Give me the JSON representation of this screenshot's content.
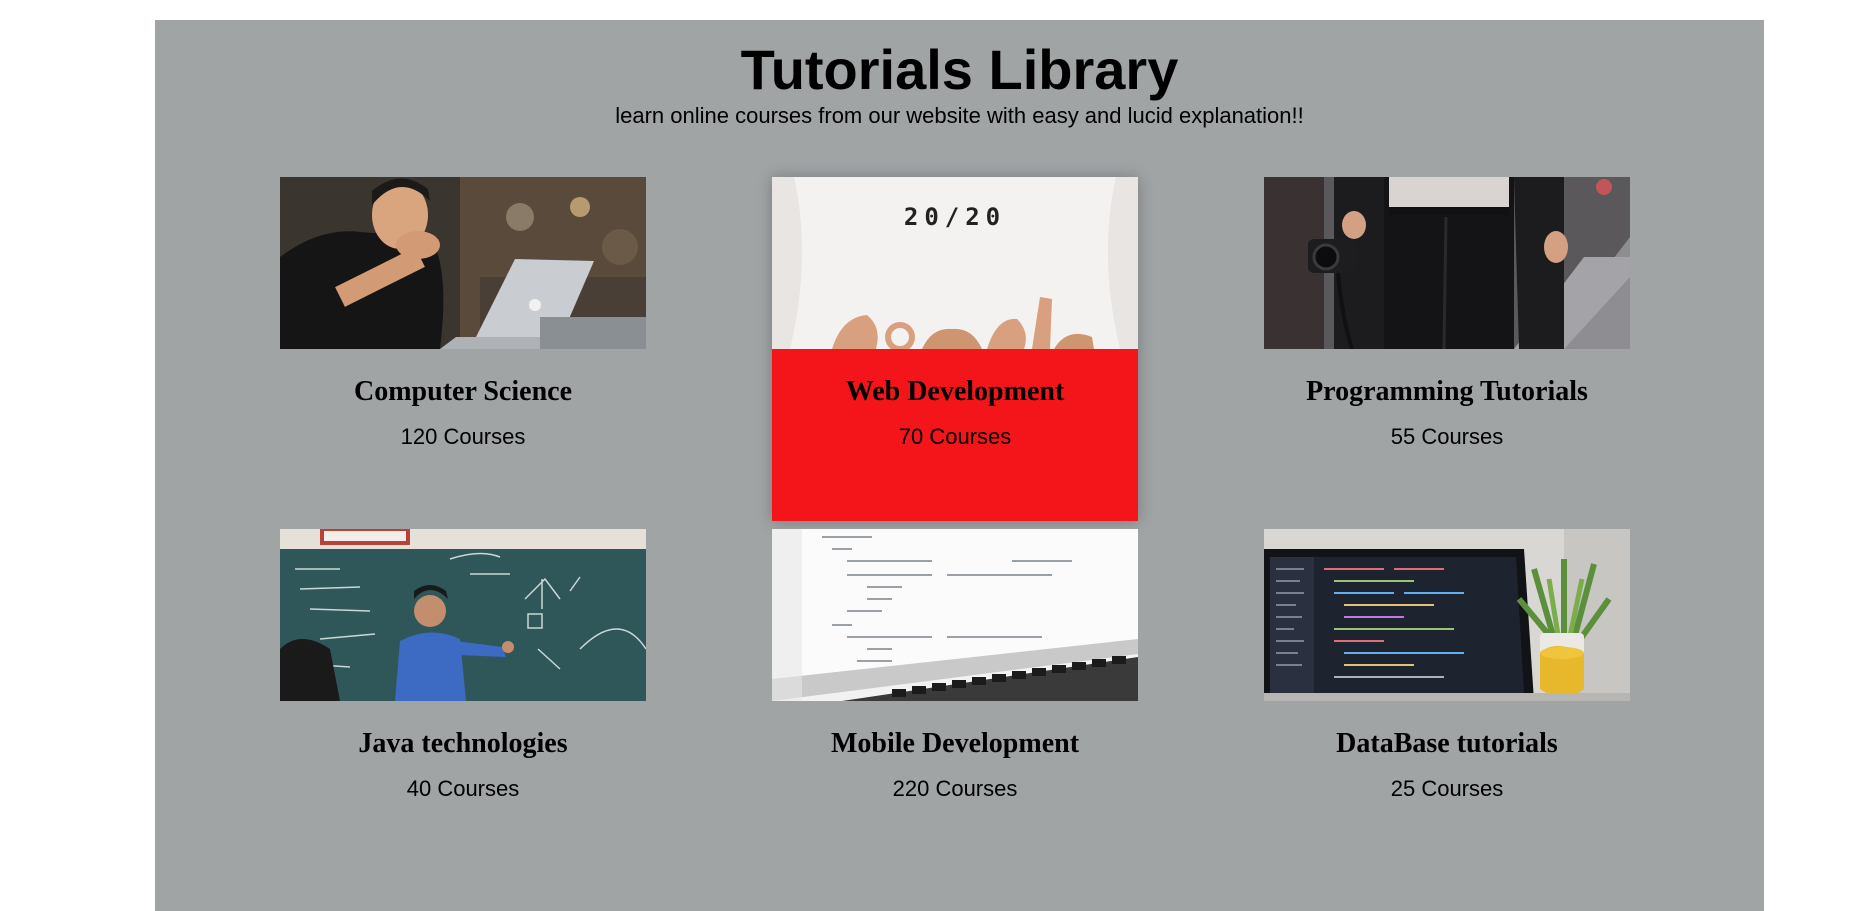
{
  "header": {
    "title": "Tutorials Library",
    "subtitle": "learn online courses from our website with easy and lucid explanation!!"
  },
  "tshirt_print": "20/20",
  "colors": {
    "page_background": "#a0a4a5",
    "highlight": "#f31519",
    "text": "#000000"
  },
  "categories": [
    {
      "title": "Computer Science",
      "count": "120 Courses",
      "image": "person-with-laptop-image",
      "highlighted": false
    },
    {
      "title": "Web Development",
      "count": "70 Courses",
      "image": "tshirt-20-20-image",
      "highlighted": true
    },
    {
      "title": "Programming Tutorials",
      "count": "55 Courses",
      "image": "person-with-camera-image",
      "highlighted": false
    },
    {
      "title": "Java technologies",
      "count": "40 Courses",
      "image": "teacher-at-chalkboard-image",
      "highlighted": false
    },
    {
      "title": "Mobile Development",
      "count": "220 Courses",
      "image": "laptop-code-screen-image",
      "highlighted": false
    },
    {
      "title": "DataBase tutorials",
      "count": "25 Courses",
      "image": "laptop-with-plant-image",
      "highlighted": false
    }
  ]
}
